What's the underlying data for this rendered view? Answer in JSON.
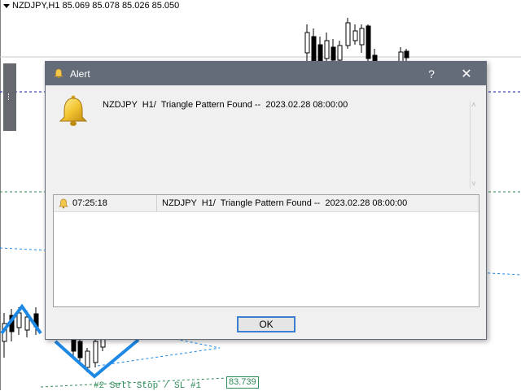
{
  "chart": {
    "symbol_info": "NZDJPY,H1  85.069 85.078 85.026 85.050",
    "price_label": "83.739",
    "sell_label": "#2 Sell Stop / SL #1"
  },
  "dialog": {
    "title": "Alert",
    "help_label": "?",
    "close_label": "✕",
    "message": "NZDJPY  H1/  Triangle Pattern Found --  2023.02.28 08:00:00",
    "log": [
      {
        "time": "07:25:18",
        "message": "NZDJPY  H1/  Triangle Pattern Found --  2023.02.28 08:00:00"
      }
    ],
    "ok_label": "OK"
  },
  "colors": {
    "titlebar": "#646c79",
    "accent_blue": "#1e88e5",
    "level_green": "#2e8b57"
  },
  "icons": {
    "title_icon": "bell-icon",
    "message_icon": "bell-icon",
    "row_icon": "bell-icon"
  }
}
